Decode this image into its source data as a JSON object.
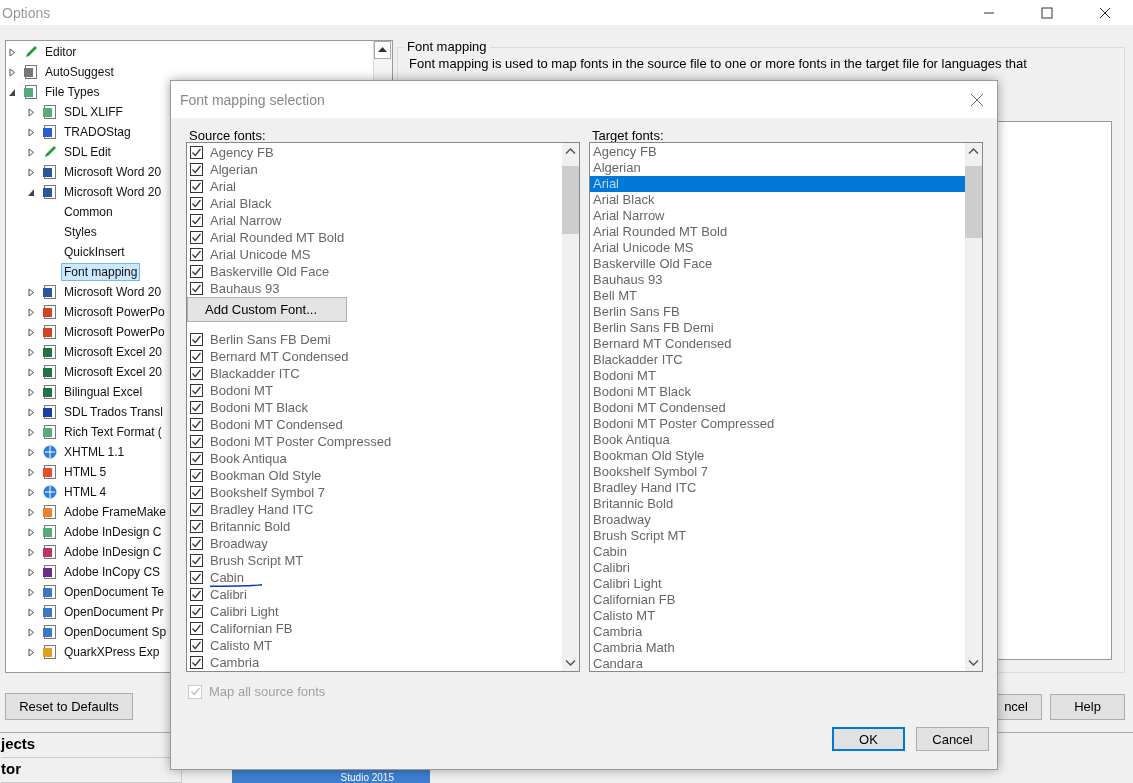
{
  "window": {
    "title": "Options"
  },
  "tree": [
    {
      "label": "Editor",
      "expanded": false,
      "selected": false
    },
    {
      "label": "AutoSuggest",
      "expanded": false,
      "selected": false
    },
    {
      "label": "File Types",
      "expanded": true,
      "selected": false,
      "children": [
        {
          "label": "SDL XLIFF",
          "expanded": false,
          "selected": false
        },
        {
          "label": "TRADOStag",
          "expanded": false,
          "selected": false
        },
        {
          "label": "SDL Edit",
          "expanded": false,
          "selected": false
        },
        {
          "label": "Microsoft Word 20",
          "expanded": false,
          "selected": false
        },
        {
          "label": "Microsoft Word 20",
          "expanded": true,
          "selected": false,
          "children": [
            {
              "label": "Common",
              "selected": false
            },
            {
              "label": "Styles",
              "selected": false
            },
            {
              "label": "QuickInsert",
              "selected": false
            },
            {
              "label": "Font mapping",
              "selected": true
            }
          ]
        },
        {
          "label": "Microsoft Word 20",
          "expanded": false,
          "selected": false
        },
        {
          "label": "Microsoft PowerPo",
          "expanded": false,
          "selected": false
        },
        {
          "label": "Microsoft PowerPo",
          "expanded": false,
          "selected": false
        },
        {
          "label": "Microsoft Excel 20",
          "expanded": false,
          "selected": false
        },
        {
          "label": "Microsoft Excel 20",
          "expanded": false,
          "selected": false
        },
        {
          "label": "Bilingual Excel",
          "expanded": false,
          "selected": false
        },
        {
          "label": "SDL Trados Transl",
          "expanded": false,
          "selected": false
        },
        {
          "label": "Rich Text Format (",
          "expanded": false,
          "selected": false
        },
        {
          "label": "XHTML 1.1",
          "expanded": false,
          "selected": false
        },
        {
          "label": "HTML 5",
          "expanded": false,
          "selected": false
        },
        {
          "label": "HTML 4",
          "expanded": false,
          "selected": false
        },
        {
          "label": "Adobe FrameMake",
          "expanded": false,
          "selected": false
        },
        {
          "label": "Adobe InDesign C",
          "expanded": false,
          "selected": false
        },
        {
          "label": "Adobe InDesign C",
          "expanded": false,
          "selected": false
        },
        {
          "label": "Adobe InCopy CS",
          "expanded": false,
          "selected": false
        },
        {
          "label": "OpenDocument Te",
          "expanded": false,
          "selected": false
        },
        {
          "label": "OpenDocument Pr",
          "expanded": false,
          "selected": false
        },
        {
          "label": "OpenDocument Sp",
          "expanded": false,
          "selected": false
        },
        {
          "label": "QuarkXPress Exp",
          "expanded": false,
          "selected": false
        }
      ]
    }
  ],
  "group": {
    "title": "Font mapping",
    "description": "Font mapping is used to map fonts in the source file to one or more fonts in the target file for languages that"
  },
  "reset_button": "Reset to Defaults",
  "footer_buttons": [
    "ncel",
    "Help"
  ],
  "background": {
    "items": [
      "jects",
      "tor"
    ],
    "banner": "Studio 2015"
  },
  "dialog": {
    "title": "Font mapping selection",
    "source_label": "Source fonts:",
    "target_label": "Target fonts:",
    "source_fonts": [
      {
        "name": "Agency FB",
        "checked": true
      },
      {
        "name": "Algerian",
        "checked": true
      },
      {
        "name": "Arial",
        "checked": true
      },
      {
        "name": "Arial Black",
        "checked": true
      },
      {
        "name": "Arial Narrow",
        "checked": true
      },
      {
        "name": "Arial Rounded MT Bold",
        "checked": true
      },
      {
        "name": "Arial Unicode MS",
        "checked": true
      },
      {
        "name": "Baskerville Old Face",
        "checked": true
      },
      {
        "name": "Bauhaus 93",
        "checked": true
      },
      {
        "name": "Berlin Sans FB Demi",
        "checked": true
      },
      {
        "name": "Bernard MT Condensed",
        "checked": true
      },
      {
        "name": "Blackadder ITC",
        "checked": true
      },
      {
        "name": "Bodoni MT",
        "checked": true
      },
      {
        "name": "Bodoni MT Black",
        "checked": true
      },
      {
        "name": "Bodoni MT Condensed",
        "checked": true
      },
      {
        "name": "Bodoni MT Poster Compressed",
        "checked": true
      },
      {
        "name": "Book Antiqua",
        "checked": true
      },
      {
        "name": "Bookman Old Style",
        "checked": true
      },
      {
        "name": "Bookshelf Symbol 7",
        "checked": true
      },
      {
        "name": "Bradley Hand ITC",
        "checked": true
      },
      {
        "name": "Britannic Bold",
        "checked": true
      },
      {
        "name": "Broadway",
        "checked": true
      },
      {
        "name": "Brush Script MT",
        "checked": true
      },
      {
        "name": "Cabin",
        "checked": true
      },
      {
        "name": "Calibri",
        "checked": true
      },
      {
        "name": "Calibri Light",
        "checked": true
      },
      {
        "name": "Californian FB",
        "checked": true
      },
      {
        "name": "Calisto MT",
        "checked": true
      },
      {
        "name": "Cambria",
        "checked": true
      }
    ],
    "context_menu": [
      "Add Custom Font..."
    ],
    "target_fonts": [
      {
        "name": "Agency FB",
        "selected": false
      },
      {
        "name": "Algerian",
        "selected": false
      },
      {
        "name": "Arial",
        "selected": true
      },
      {
        "name": "Arial Black",
        "selected": false
      },
      {
        "name": "Arial Narrow",
        "selected": false
      },
      {
        "name": "Arial Rounded MT Bold",
        "selected": false
      },
      {
        "name": "Arial Unicode MS",
        "selected": false
      },
      {
        "name": "Baskerville Old Face",
        "selected": false
      },
      {
        "name": "Bauhaus 93",
        "selected": false
      },
      {
        "name": "Bell MT",
        "selected": false
      },
      {
        "name": "Berlin Sans FB",
        "selected": false
      },
      {
        "name": "Berlin Sans FB Demi",
        "selected": false
      },
      {
        "name": "Bernard MT Condensed",
        "selected": false
      },
      {
        "name": "Blackadder ITC",
        "selected": false
      },
      {
        "name": "Bodoni MT",
        "selected": false
      },
      {
        "name": "Bodoni MT Black",
        "selected": false
      },
      {
        "name": "Bodoni MT Condensed",
        "selected": false
      },
      {
        "name": "Bodoni MT Poster Compressed",
        "selected": false
      },
      {
        "name": "Book Antiqua",
        "selected": false
      },
      {
        "name": "Bookman Old Style",
        "selected": false
      },
      {
        "name": "Bookshelf Symbol 7",
        "selected": false
      },
      {
        "name": "Bradley Hand ITC",
        "selected": false
      },
      {
        "name": "Britannic Bold",
        "selected": false
      },
      {
        "name": "Broadway",
        "selected": false
      },
      {
        "name": "Brush Script MT",
        "selected": false
      },
      {
        "name": "Cabin",
        "selected": false
      },
      {
        "name": "Calibri",
        "selected": false
      },
      {
        "name": "Calibri Light",
        "selected": false
      },
      {
        "name": "Californian FB",
        "selected": false
      },
      {
        "name": "Calisto MT",
        "selected": false
      },
      {
        "name": "Cambria",
        "selected": false
      },
      {
        "name": "Cambria Math",
        "selected": false
      },
      {
        "name": "Candara",
        "selected": false
      }
    ],
    "map_all": {
      "label": "Map all source fonts",
      "checked": true,
      "disabled": true
    },
    "buttons": [
      {
        "label": "OK",
        "default": true
      },
      {
        "label": "Cancel",
        "default": false
      }
    ]
  }
}
